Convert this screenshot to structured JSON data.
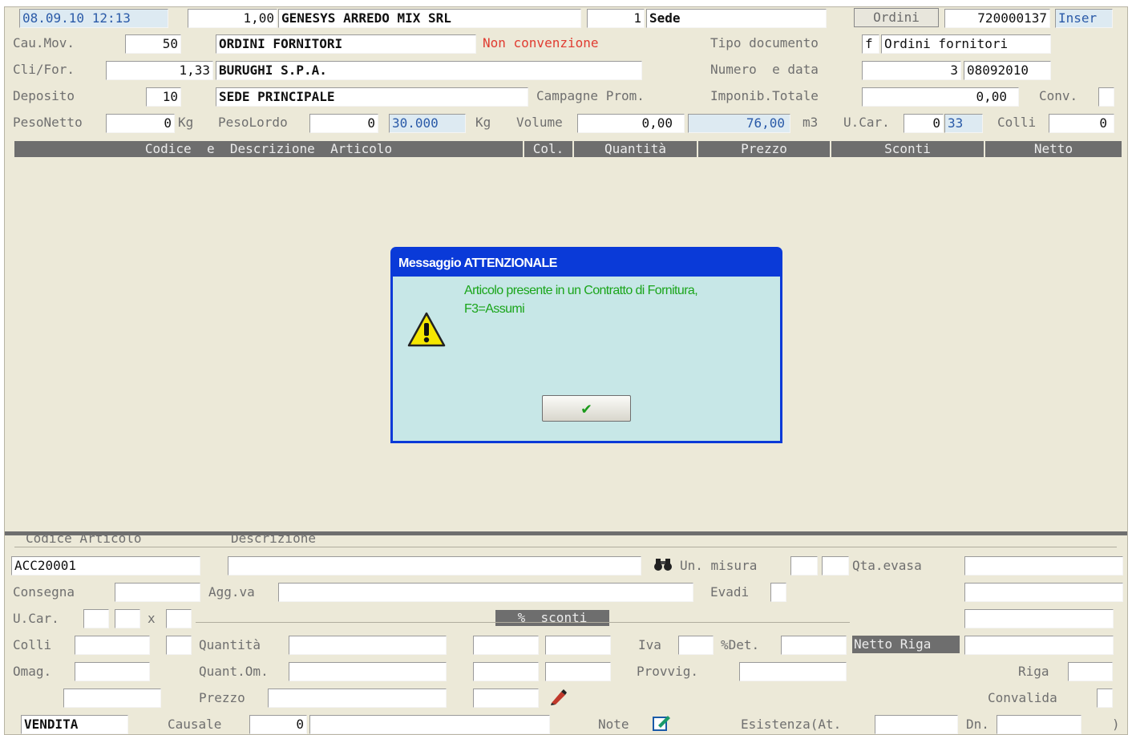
{
  "top": {
    "datetime": "08.09.10 12:13",
    "code_value": "1,00",
    "company": "GENESYS ARREDO MIX SRL",
    "site_num": "1",
    "site_name": "Sede",
    "orders_button": "Ordini",
    "order_number": "720000137",
    "mode": "Inser"
  },
  "row1": {
    "cau_label": "Cau.Mov.",
    "cau_value": "50",
    "cau_desc": "ORDINI FORNITORI",
    "non_conv": "Non convenzione",
    "tipo_label": "Tipo documento",
    "tipo_code": "f",
    "tipo_desc": "Ordini fornitori"
  },
  "row2": {
    "cli_label": "Cli/For.",
    "cli_value": "1,33",
    "cli_name": "BURUGHI S.P.A.",
    "numero_label": "Numero  e data",
    "numero_value": "3",
    "data_value": "08092010"
  },
  "row3": {
    "dep_label": "Deposito",
    "dep_value": "10",
    "dep_name": "SEDE PRINCIPALE",
    "campagne_label": "Campagne Prom.",
    "imponib_label": "Imponib.Totale",
    "imponib_value": "0,00",
    "conv_label": "Conv."
  },
  "row4": {
    "pesonetto_label": "PesoNetto",
    "pesonetto_value": "0",
    "kg1": "Kg",
    "pesolordo_label": "PesoLordo",
    "pesolordo_value": "0",
    "pesolordo_blue": "30.000",
    "kg2": "Kg",
    "volume_label": "Volume",
    "volume_value": "0,00",
    "volume_blue": "76,00",
    "m3": "m3",
    "ucar_label": "U.Car.",
    "ucar_value": "0",
    "ucar_blue": "33",
    "colli_label": "Colli",
    "colli_value": "0"
  },
  "grid_headers": [
    "Codice  e  Descrizione  Articolo",
    "Col.",
    "Quantità",
    "Prezzo",
    "Sconti",
    "Netto"
  ],
  "dialog": {
    "title": "Messaggio ATTENZIONALE",
    "line1": "Articolo presente in un Contratto di Fornitura,",
    "line2": "F3=Assumi",
    "ok_symbol": "✔"
  },
  "bottom": {
    "codice_label": "Codice Articolo",
    "descr_label": "Descrizione",
    "codice_value": "ACC20001",
    "um_label": "Un. misura",
    "qta_evasa_label": "Qta.evasa",
    "consegna_label": "Consegna",
    "aggva_label": "Agg.va",
    "evadi_label": "Evadi",
    "ucar_label": "U.Car.",
    "x_label": "x",
    "sconti_label": "%  sconti",
    "colli_label": "Colli",
    "quantita_label": "Quantità",
    "iva_label": "Iva",
    "det_label": "%Det.",
    "netto_riga_label": "Netto Riga",
    "omag_label": "Omag.",
    "quant_om_label": "Quant.Om.",
    "provvig_label": "Provvig.",
    "riga_label": "Riga",
    "prezzo_label": "Prezzo",
    "convalida_label": "Convalida",
    "vendita_value": "VENDITA",
    "causale_label": "Causale",
    "causale_value": "0",
    "note_label": "Note",
    "esistenza_label": "Esistenza(At.",
    "dn_label": "Dn.",
    "close_paren": ")"
  }
}
